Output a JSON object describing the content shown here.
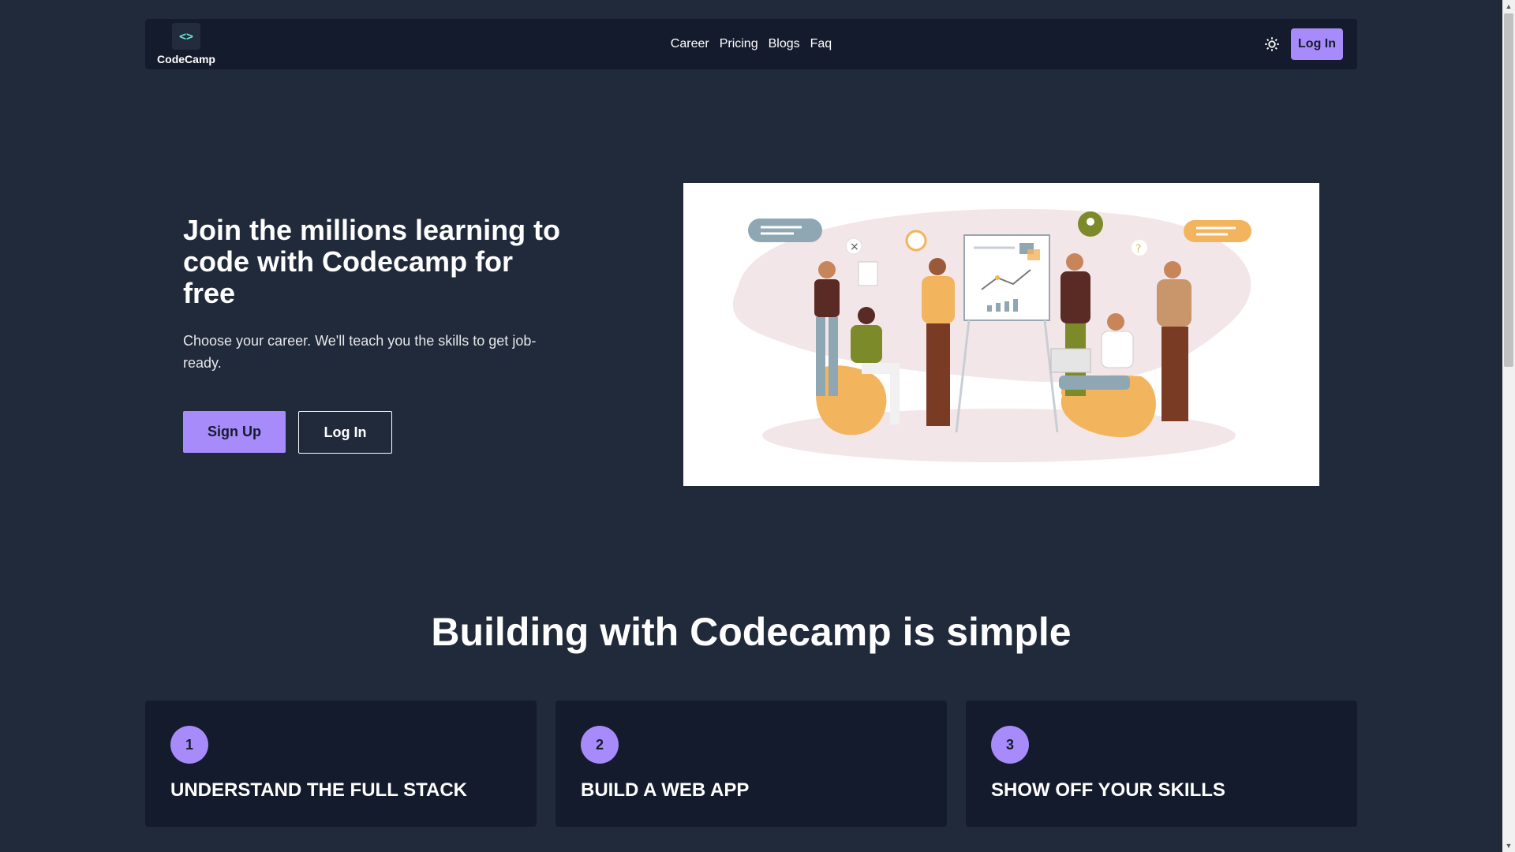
{
  "brand": {
    "name": "CodeCamp",
    "logo_glyph": "<>",
    "accent": "#a78bfa",
    "logo_color": "#5eead4"
  },
  "nav": {
    "links": [
      "Career",
      "Pricing",
      "Blogs",
      "Faq"
    ],
    "theme_icon": "sun-icon",
    "login_label": "Log In"
  },
  "hero": {
    "title": "Join the millions learning to code with Codecamp for free",
    "subtitle": "Choose your career. We'll teach you the skills to get job-ready.",
    "signup_label": "Sign Up",
    "login_label": "Log In",
    "illustration": "team-collaboration-illustration"
  },
  "steps_section": {
    "title": "Building with Codecamp is simple",
    "steps": [
      {
        "number": "1",
        "label": "UNDERSTAND THE FULL STACK"
      },
      {
        "number": "2",
        "label": "BUILD A WEB APP"
      },
      {
        "number": "3",
        "label": "SHOW OFF YOUR SKILLS"
      }
    ]
  },
  "colors": {
    "page_bg": "#212a3a",
    "card_bg": "#141b2d",
    "text": "#ffffff"
  }
}
